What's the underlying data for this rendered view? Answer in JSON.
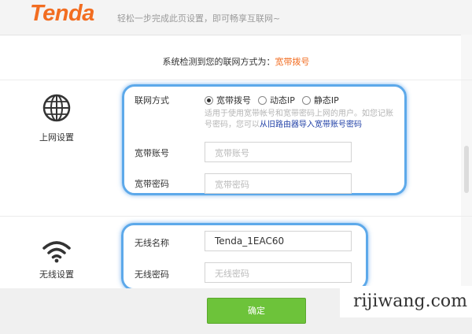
{
  "header": {
    "logo": "Tenda",
    "tagline": "轻松一步完成此页设置，即可畅享互联网~"
  },
  "detect": {
    "prefix": "系统检测到您的联网方式为：",
    "value": "宽带拨号"
  },
  "internet_section": {
    "icon": "globe-icon",
    "label": "上网设置",
    "mode_label": "联网方式",
    "modes": [
      "宽带拨号",
      "动态IP",
      "静态IP"
    ],
    "selected_mode": "宽带拨号",
    "hint_text": "适用于使用宽带帐号和宽带密码上网的用户。如您记账号密码，您可以",
    "hint_link": "从旧路由器导入宽带账号密码",
    "account_label": "宽带账号",
    "account_placeholder": "宽带账号",
    "password_label": "宽带密码",
    "password_placeholder": "宽带密码"
  },
  "wireless_section": {
    "icon": "wifi-icon",
    "label": "无线设置",
    "ssid_label": "无线名称",
    "ssid_value": "Tenda_1EAC60",
    "wpass_label": "无线密码",
    "wpass_placeholder": "无线密码"
  },
  "confirm_label": "确定",
  "watermark": "rijiwang.com",
  "colors": {
    "brand": "#f26d21",
    "confirm": "#6dc33a",
    "highlight": "#5da9ea",
    "link": "#1f3fa6"
  }
}
